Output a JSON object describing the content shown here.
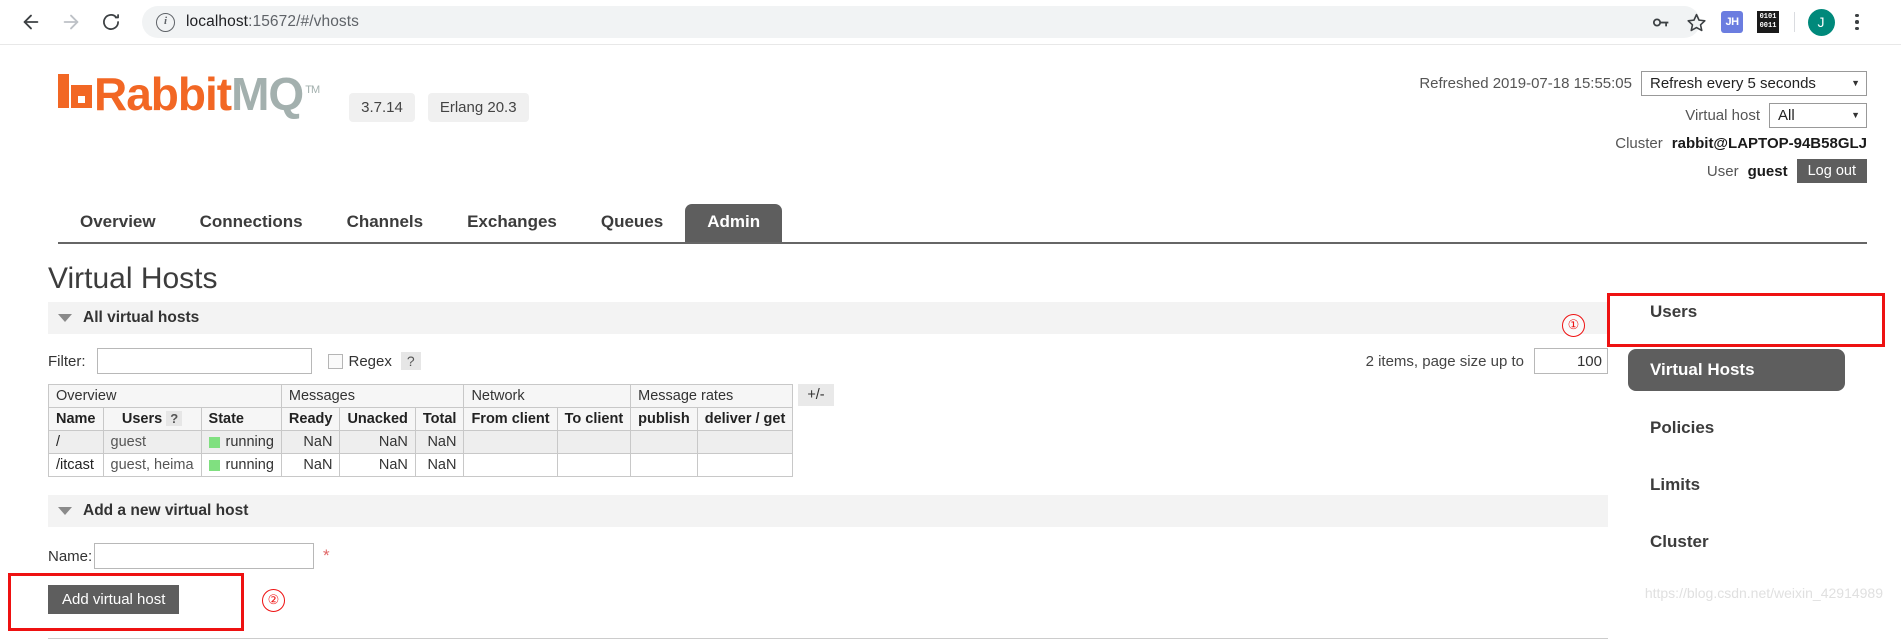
{
  "browser": {
    "back_label": "back",
    "forward_label": "forward",
    "reload_label": "reload",
    "url_host": "localhost",
    "url_rest": ":15672/#/vhosts",
    "extensions": [
      {
        "name": "password-key-icon",
        "label": "key"
      },
      {
        "name": "bookmark-star-icon",
        "label": "star"
      },
      {
        "name": "extension-jh-icon",
        "label": "JH"
      },
      {
        "name": "extension-binary-icon",
        "label_top": "0101",
        "label_bottom": "0011"
      },
      {
        "name": "profile-avatar",
        "label": "J"
      },
      {
        "name": "chrome-menu-icon",
        "label": "menu"
      }
    ]
  },
  "header": {
    "logo_rabbit": "Rabbit",
    "logo_mq": "MQ",
    "logo_tm": "TM",
    "version_badge": "3.7.14",
    "erlang_badge": "Erlang 20.3",
    "refreshed_label": "Refreshed 2019-07-18 15:55:05",
    "refresh_select_value": "Refresh every 5 seconds",
    "vhost_label": "Virtual host",
    "vhost_select_value": "All",
    "cluster_label": "Cluster",
    "cluster_value": "rabbit@LAPTOP-94B58GLJ",
    "user_label": "User",
    "user_value": "guest",
    "logout_label": "Log out"
  },
  "tabs": [
    {
      "label": "Overview",
      "active": false
    },
    {
      "label": "Connections",
      "active": false
    },
    {
      "label": "Channels",
      "active": false
    },
    {
      "label": "Exchanges",
      "active": false
    },
    {
      "label": "Queues",
      "active": false
    },
    {
      "label": "Admin",
      "active": true
    }
  ],
  "main": {
    "page_title": "Virtual Hosts",
    "all_vhosts_section": "All virtual hosts",
    "filter_label": "Filter:",
    "filter_value": "",
    "regex_label": "Regex",
    "help_mark": "?",
    "page_size_label": "2 items, page size up to",
    "page_size_value": "100",
    "plus_minus": "+/-",
    "group_headers": [
      "Overview",
      "Messages",
      "Network",
      "Message rates"
    ],
    "sub_headers": [
      "Name",
      "Users",
      "?",
      "State",
      "Ready",
      "Unacked",
      "Total",
      "From client",
      "To client",
      "publish",
      "deliver / get"
    ],
    "rows": [
      {
        "name": "/",
        "users": "guest",
        "state": "running",
        "ready": "NaN",
        "unacked": "NaN",
        "total": "NaN",
        "from_client": "",
        "to_client": "",
        "publish": "",
        "deliver_get": ""
      },
      {
        "name": "/itcast",
        "users": "guest, heima",
        "state": "running",
        "ready": "NaN",
        "unacked": "NaN",
        "total": "NaN",
        "from_client": "",
        "to_client": "",
        "publish": "",
        "deliver_get": ""
      }
    ],
    "add_section": "Add a new virtual host",
    "name_label": "Name:",
    "name_value": "",
    "required_mark": "*",
    "add_button": "Add virtual host"
  },
  "sidebar": [
    {
      "label": "Users",
      "active": false
    },
    {
      "label": "Virtual Hosts",
      "active": true
    },
    {
      "label": "Policies",
      "active": false
    },
    {
      "label": "Limits",
      "active": false
    },
    {
      "label": "Cluster",
      "active": false
    }
  ],
  "annotations": {
    "marker_one": "①",
    "marker_two": "②",
    "highlight_color": "#ee1111"
  },
  "watermark": "https://blog.csdn.net/weixin_42914989"
}
